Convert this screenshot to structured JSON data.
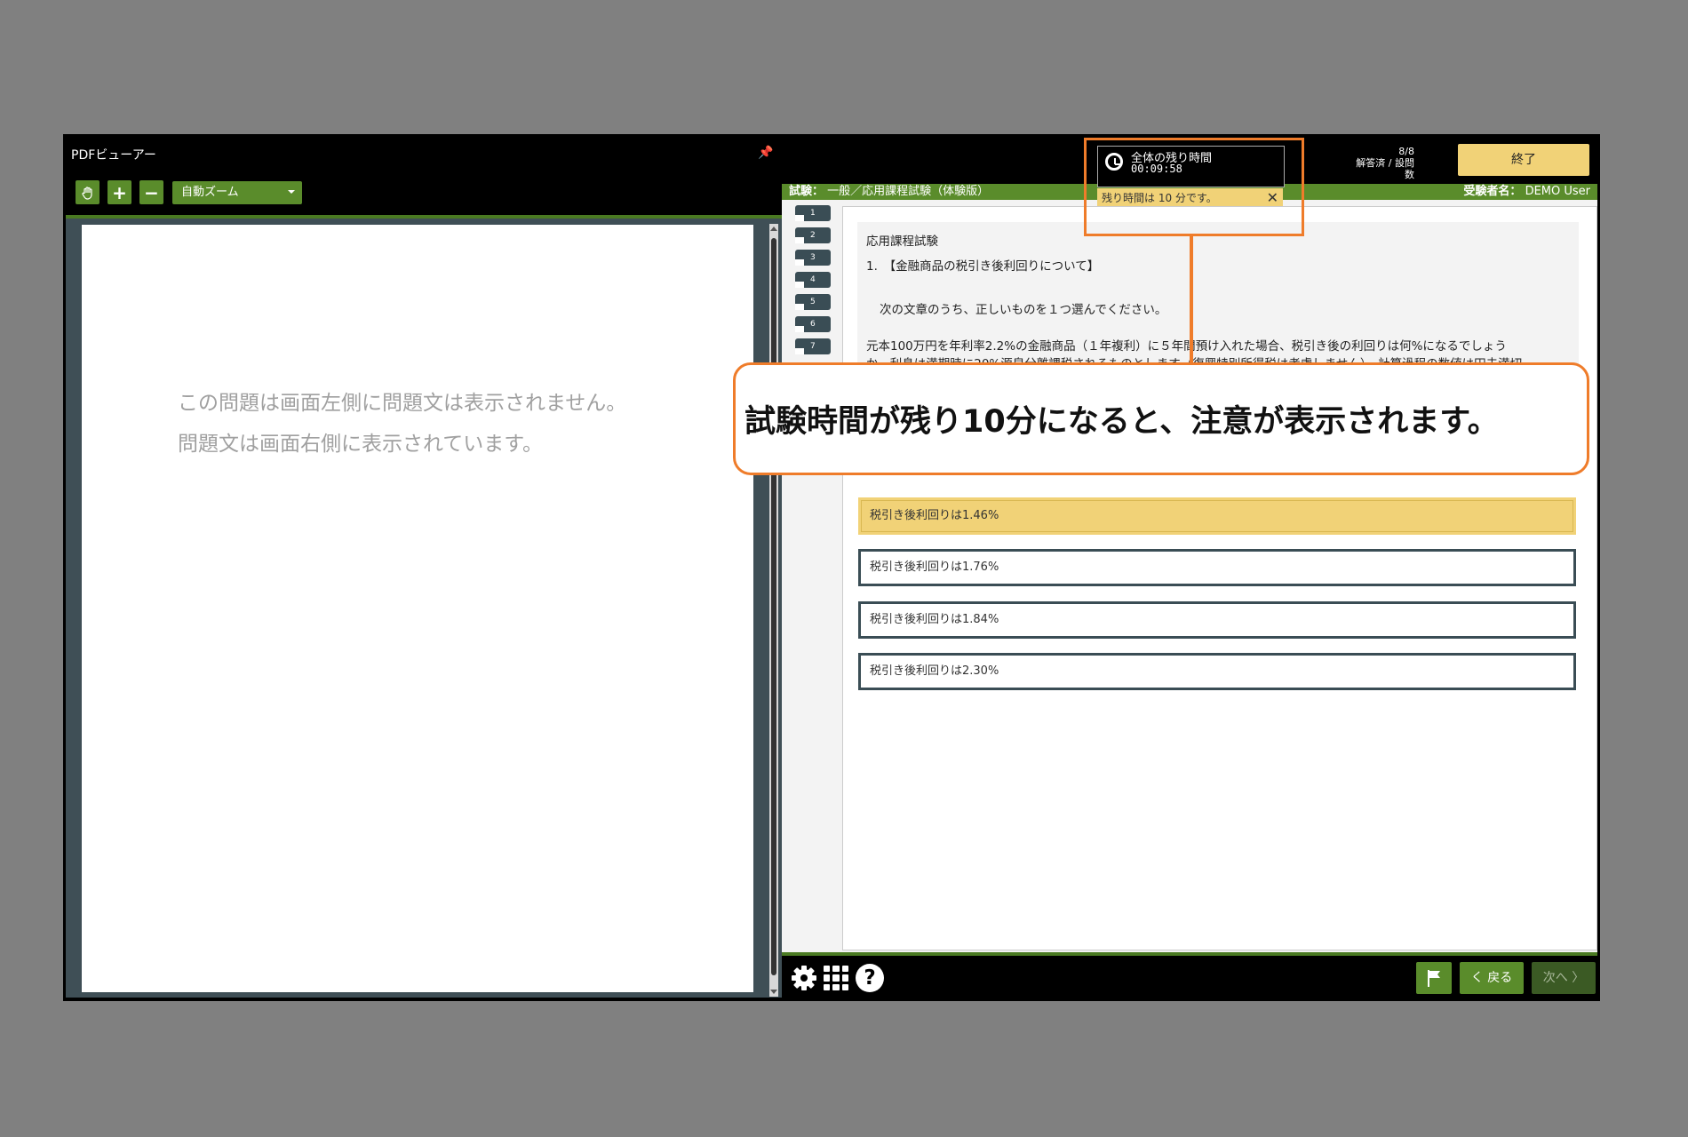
{
  "pdf_viewer": {
    "title": "PDFビューアー",
    "zoom": "自動ズーム",
    "message_line1": "この問題は画面左側に問題文は表示されません。",
    "message_line2": "問題文は画面右側に表示されています。"
  },
  "timer": {
    "label": "全体の残り時間",
    "time": "00:09:58",
    "warning": "残り時間は 10 分です。",
    "close": "✕"
  },
  "progress": {
    "count": "8/8",
    "label": "解答済 / 設問数"
  },
  "end_button": "終了",
  "exam_header": {
    "exam_label": "試験：",
    "exam_name": "一般／応用課程試験（体験版）",
    "examinee_label": "受験者名：",
    "examinee_name": "DEMO User"
  },
  "question_tabs": [
    "1",
    "2",
    "3",
    "4",
    "5",
    "6",
    "7"
  ],
  "question": {
    "course": "応用課程試験",
    "title": "1.　【金融商品の税引き後利回りについて】",
    "instruction": "次の文章のうち、正しいものを１つ選んでください。",
    "body_line1": "元本100万円を年利率2.2%の金融商品（１年複利）に５年間預け入れた場合、税引き後の利回りは何%になるでしょう",
    "body_line2": "か。利息は満期時に20%源泉分離課税されるものとします（復興特別所得税は考慮しません）。計算過程の数値は円未満切"
  },
  "choices": [
    {
      "label": "税引き後利回りは1.46%",
      "selected": true
    },
    {
      "label": "税引き後利回りは1.76%",
      "selected": false
    },
    {
      "label": "税引き後利回りは1.84%",
      "selected": false
    },
    {
      "label": "税引き後利回りは2.30%",
      "selected": false
    }
  ],
  "nav": {
    "back": "く 戻る",
    "next": "次へ 〉"
  },
  "callout": "試験時間が残り10分になると、注意が表示されます。",
  "colors": {
    "accent_green": "#5a8c2b",
    "highlight_yellow": "#f1d277",
    "callout_orange": "#ef7c2a"
  }
}
